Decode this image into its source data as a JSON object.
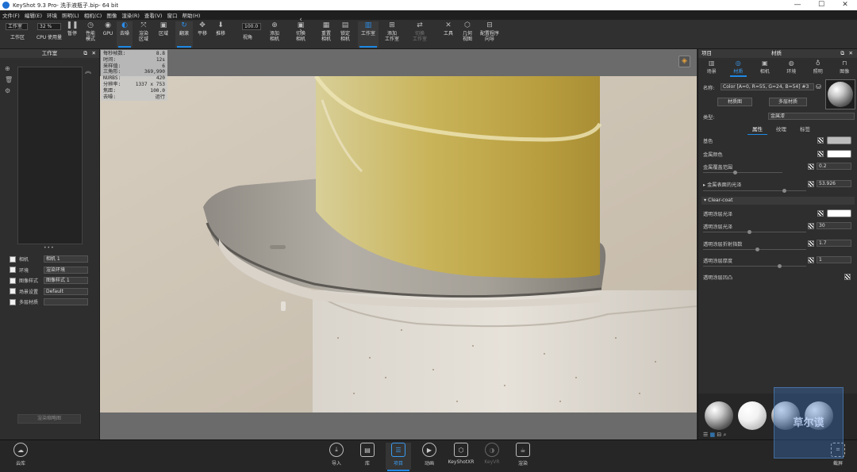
{
  "titlebar": {
    "app": "KeyShot 9.3 Pro",
    "file": " - 洗手液瓶子.bip",
    "bits": " - 64 bit"
  },
  "menu": [
    "文件(F)",
    "编辑(E)",
    "环境",
    "照明(L)",
    "相机(C)",
    "图像",
    "渲染(R)",
    "查看(V)",
    "窗口",
    "帮助(H)"
  ],
  "ribbon": {
    "workspace_select": "工作室",
    "workspace_label": "工作区",
    "cpu_value": "32 %",
    "cpu_label": "CPU 使用量",
    "pause": "暂停",
    "perf": [
      "性能",
      "模式"
    ],
    "gpu": "GPU",
    "denoise": "去噪",
    "render_region": [
      "渲染",
      "区域"
    ],
    "region": "区域",
    "tumble": "翻滚",
    "pan": "平移",
    "dolly": "推移",
    "fov_value": "100.0",
    "fov_label": "视角",
    "add_camera": [
      "添加",
      "相机"
    ],
    "switch_camera": [
      "切换",
      "相机"
    ],
    "reset_camera": [
      "重置",
      "相机"
    ],
    "lock_camera": [
      "锁定",
      "相机"
    ],
    "studio": "工作室",
    "add_studio": [
      "添加",
      "工作室"
    ],
    "switch_studio": [
      "切换",
      "工作室"
    ],
    "tools": "工具",
    "geometry_view": [
      "几何",
      "视图"
    ],
    "config_wizard": [
      "配置程序",
      "向导"
    ]
  },
  "left_panel": {
    "title": "工作室",
    "rows": [
      {
        "label": "相机",
        "value": "相机 1"
      },
      {
        "label": "环境",
        "value": "渲染环境"
      },
      {
        "label": "图像样式",
        "value": "图像样式 1"
      },
      {
        "label": "场景设置",
        "value": "Default"
      },
      {
        "label": "多层材质",
        "value": ""
      }
    ],
    "render_button": "渲染缩略图"
  },
  "hud": [
    {
      "k": "每秒帧数:",
      "v": "8.8"
    },
    {
      "k": "时间:",
      "v": "12s"
    },
    {
      "k": "采样值:",
      "v": "6"
    },
    {
      "k": "三角形:",
      "v": "369,990"
    },
    {
      "k": "NURBS:",
      "v": "420"
    },
    {
      "k": "分辨率:",
      "v": "1337 x 753"
    },
    {
      "k": "焦距:",
      "v": "100.0"
    },
    {
      "k": "去噪:",
      "v": "运行"
    }
  ],
  "right_panel": {
    "left_title": "项目",
    "title": "材质",
    "tabs": [
      {
        "label": "场景",
        "icon": "scene-icon"
      },
      {
        "label": "材质",
        "icon": "material-icon"
      },
      {
        "label": "相机",
        "icon": "camera-icon"
      },
      {
        "label": "环境",
        "icon": "environment-icon"
      },
      {
        "label": "照明",
        "icon": "light-icon"
      },
      {
        "label": "图像",
        "icon": "image-icon"
      }
    ],
    "name_label": "名称:",
    "name_value": "Color [A=0, R=55, G=24, B=54] #3",
    "material_graph_button": "材质图",
    "multi_material_button": "多层材质",
    "type_label": "类型:",
    "type_value": "金属漆",
    "subtabs": [
      "属性",
      "纹理",
      "标签"
    ],
    "props": [
      {
        "label": "基色",
        "kind": "color",
        "color": "#bdbdbd"
      },
      {
        "label": "金属颜色",
        "kind": "color",
        "color": "#ffffff"
      },
      {
        "label": "金属覆盖范围",
        "kind": "value",
        "value": "0.2"
      },
      {
        "label": "金属表面的光泽",
        "kind": "value",
        "value": "53.926"
      }
    ],
    "clearcoat_title": "Clear-coat",
    "clearcoat": [
      {
        "label": "透明涂层光泽",
        "kind": "color",
        "color": "#ffffff"
      },
      {
        "label": "透明涂层光泽",
        "kind": "value",
        "value": "30"
      },
      {
        "label": "透明涂层折射指数",
        "kind": "value",
        "value": "1.7"
      },
      {
        "label": "透明涂层厚度",
        "kind": "value",
        "value": "1"
      },
      {
        "label": "透明涂层凹凸",
        "kind": "none"
      }
    ]
  },
  "bottom_bar": {
    "cloud": "云库",
    "import": "导入",
    "library": "库",
    "project": "项目",
    "animation": "动画",
    "keyshotxr": "KeyShotXR",
    "keyvr": "KeyVR",
    "render": "渲染",
    "screenshot": "截屏"
  },
  "watermark": "草尔谟"
}
